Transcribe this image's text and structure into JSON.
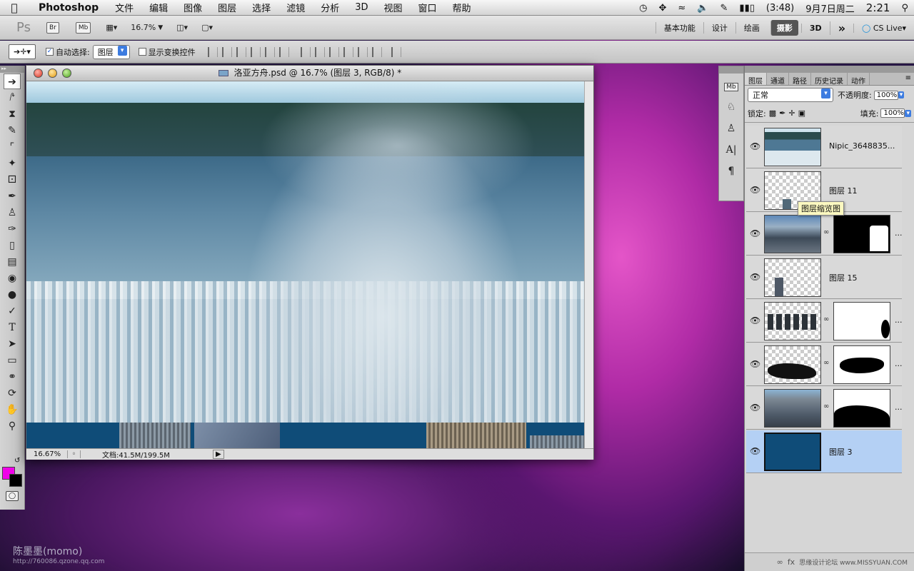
{
  "menubar": {
    "app_name": "Photoshop",
    "items": [
      "文件",
      "编辑",
      "图像",
      "图层",
      "选择",
      "滤镜",
      "分析",
      "3D",
      "视图",
      "窗口",
      "帮助"
    ],
    "battery": "(3:48)",
    "date": "9月7日周二",
    "time": "2:21"
  },
  "appbar": {
    "ps_logo": "Ps",
    "br": "Br",
    "mb": "Mb",
    "zoom": "16.7%",
    "workspaces": [
      "基本功能",
      "设计",
      "绘画",
      "摄影",
      "3D"
    ],
    "active_workspace": "摄影",
    "more": "»",
    "cs_live": "CS Live"
  },
  "options": {
    "auto_select_label": "自动选择:",
    "auto_select_value": "图层",
    "show_transform_label": "显示变换控件"
  },
  "document": {
    "title": "洛亚方舟.psd @ 16.7% (图层 3, RGB/8) *",
    "zoom": "16.67%",
    "doc_info": "文档:41.5M/199.5M"
  },
  "layers_panel": {
    "tabs": [
      "图层",
      "通道",
      "路径",
      "历史记录",
      "动作"
    ],
    "active_tab": "图层",
    "blend_mode": "正常",
    "opacity_label": "不透明度:",
    "opacity": "100%",
    "lock_label": "锁定:",
    "fill_label": "填充:",
    "fill": "100%",
    "tooltip": "图层缩览图",
    "layers": [
      {
        "name": "Nipic_3648835...",
        "has_mask": false,
        "selected": false
      },
      {
        "name": "图层 11",
        "has_mask": false,
        "selected": false
      },
      {
        "name": "",
        "has_mask": true,
        "selected": false
      },
      {
        "name": "图层 15",
        "has_mask": false,
        "selected": false
      },
      {
        "name": "",
        "has_mask": true,
        "selected": false
      },
      {
        "name": "",
        "has_mask": true,
        "selected": false
      },
      {
        "name": "",
        "has_mask": true,
        "selected": false
      },
      {
        "name": "图层 3",
        "has_mask": false,
        "selected": true
      }
    ],
    "more_glyph": "...",
    "footer_text": "思缘设计论坛 www.MISSYUAN.COM"
  },
  "watermark": {
    "name": "陈墨墨(momo)",
    "url": "http://760086.qzone.qq.com"
  },
  "colors": {
    "foreground": "#f000e8",
    "background": "#000000",
    "selected_layer": "#b4d0f4",
    "layer3_fill": "#0f4c78"
  }
}
